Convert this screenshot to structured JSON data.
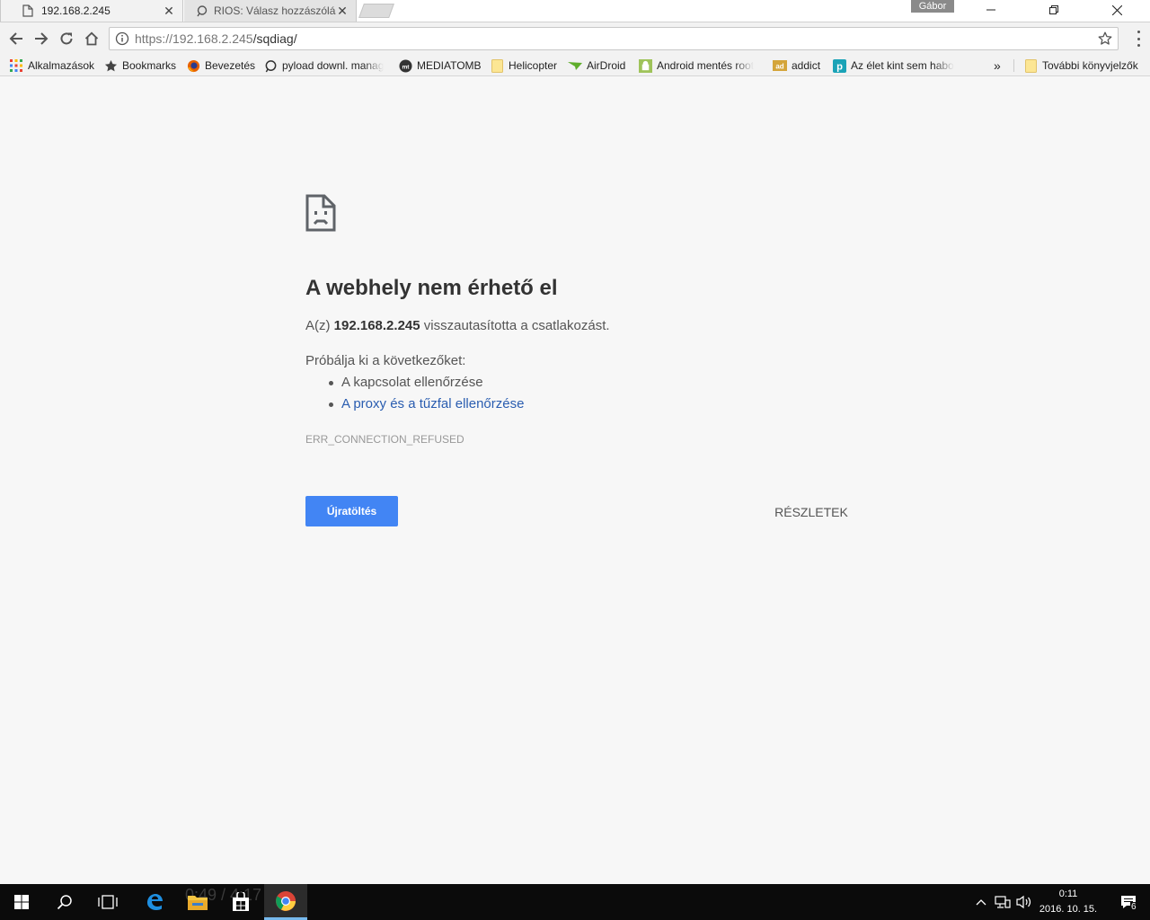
{
  "tabs": [
    {
      "title": "192.168.2.245",
      "icon": "document-icon",
      "active": true
    },
    {
      "title": "RIOS: Válasz hozzászólás",
      "icon": "forum-icon",
      "active": false
    }
  ],
  "profile": {
    "name": "Gábor"
  },
  "toolbar": {
    "url_host": "https://192.168.2.245",
    "url_path": "/sqdiag/"
  },
  "bookmarks": [
    {
      "label": "Alkalmazások",
      "icon": "apps-grid-icon"
    },
    {
      "label": "Bookmarks",
      "icon": "star-icon"
    },
    {
      "label": "Bevezetés",
      "icon": "firefox-icon"
    },
    {
      "label": "pyload downl. manag",
      "icon": "pyload-icon"
    },
    {
      "label": "MEDIATOMB",
      "icon": "mediatomb-icon"
    },
    {
      "label": "Helicopter",
      "icon": "folder-icon"
    },
    {
      "label": "AirDroid",
      "icon": "airdroid-icon"
    },
    {
      "label": "Android mentés root",
      "icon": "android-icon"
    },
    {
      "label": "addict",
      "icon": "addict-icon"
    },
    {
      "label": "Az élet kint sem habo",
      "icon": "p-icon"
    }
  ],
  "bookmarks_more": "»",
  "bookmarks_other": {
    "label": "További könyvjelzők",
    "icon": "folder-icon"
  },
  "error": {
    "title": "A webhely nem érhető el",
    "prefix": "A(z) ",
    "host": "192.168.2.245",
    "suffix": " visszautasította a csatlakozást.",
    "suggest_heading": "Próbálja ki a következőket:",
    "suggestions": [
      {
        "text": "A kapcsolat ellenőrzése",
        "link": false
      },
      {
        "text": "A proxy és a tűzfal ellenőrzése",
        "link": true
      }
    ],
    "code": "ERR_CONNECTION_REFUSED",
    "reload_label": "Újratöltés",
    "details_label": "RÉSZLETEK"
  },
  "taskbar": {
    "ghost_text": "0:49 / 4:17",
    "time": "0:11",
    "date": "2016. 10. 15.",
    "notifications": "6"
  },
  "colors": {
    "accent": "#4285f4",
    "link": "#2a5db0",
    "taskbar": "#0b0b0b"
  }
}
